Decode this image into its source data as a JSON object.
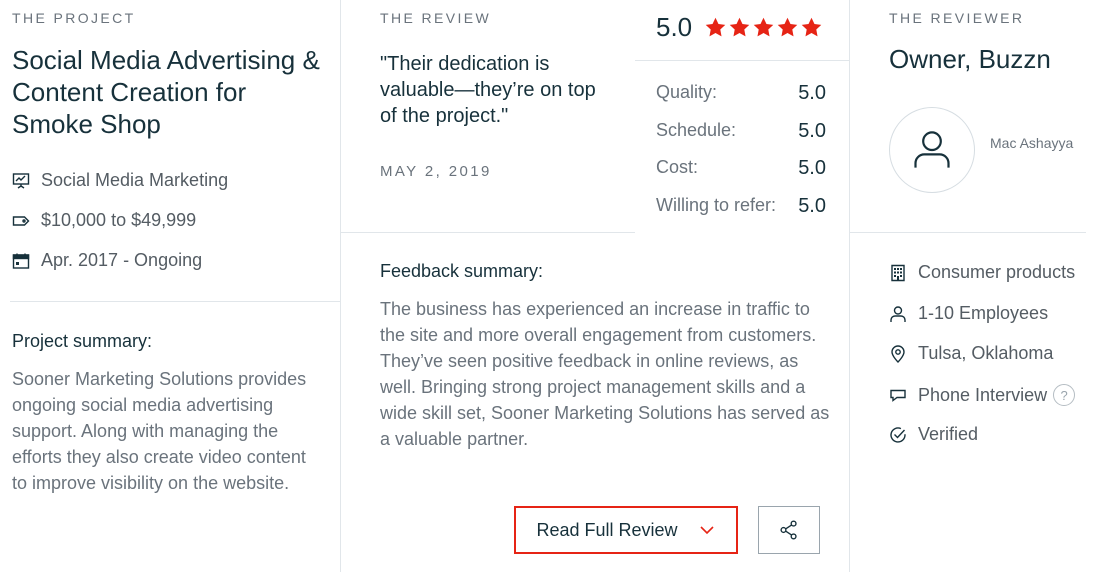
{
  "project": {
    "section_label": "THE PROJECT",
    "title": "Social Media Advertising & Content Creation for Smoke Shop",
    "service": "Social Media Marketing",
    "budget": "$10,000 to $49,999",
    "timeline": "Apr. 2017 - Ongoing",
    "summary_title": "Project summary:",
    "summary_text": "Sooner Marketing Solutions provides ongoing social media advertising support. Along with managing the efforts they also create video content to improve visibility on the website."
  },
  "review": {
    "section_label": "THE REVIEW",
    "quote": "\"Their dedication is valuable—they’re on top of the project.\"",
    "date": "MAY 2, 2019",
    "overall_score": "5.0",
    "stars": 5,
    "star_color": "#e62415",
    "ratings": [
      {
        "label": "Quality:",
        "value": "5.0"
      },
      {
        "label": "Schedule:",
        "value": "5.0"
      },
      {
        "label": "Cost:",
        "value": "5.0"
      },
      {
        "label": "Willing to refer:",
        "value": "5.0"
      }
    ],
    "feedback_title": "Feedback summary:",
    "feedback_text": "The business has experienced an increase in traffic to the site and more overall engagement from customers. They’ve seen positive feedback in online reviews, as well. Bringing strong project management skills and a wide skill set, Sooner Marketing Solutions has served as a valuable partner.",
    "read_button": "Read Full Review",
    "accent_color": "#e62415"
  },
  "reviewer": {
    "section_label": "THE REVIEWER",
    "title": "Owner, Buzzn",
    "name": "Mac Ashayya",
    "industry": "Consumer products",
    "size": "1-10 Employees",
    "location": "Tulsa, Oklahoma",
    "interview": "Phone Interview",
    "help_glyph": "?",
    "verified": "Verified"
  },
  "icons": {
    "service": "presentation-board-icon",
    "budget": "price-tag-icon",
    "timeline": "calendar-icon",
    "industry": "building-icon",
    "size": "person-icon",
    "location": "map-pin-icon",
    "interview": "chat-bubble-icon",
    "verified": "check-circle-icon",
    "share": "share-icon",
    "chevron": "chevron-down-icon"
  }
}
